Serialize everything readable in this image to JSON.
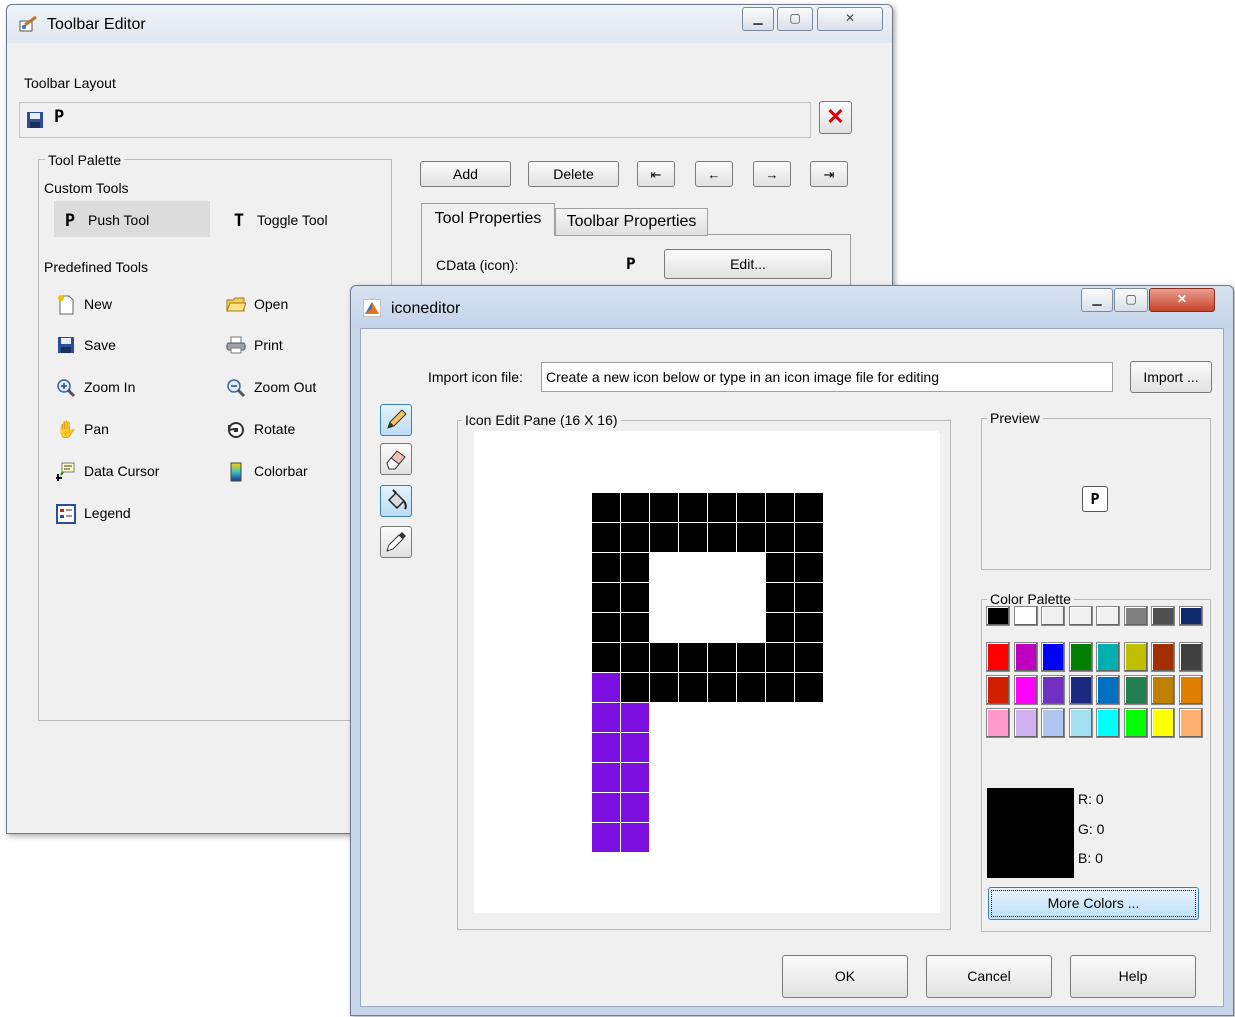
{
  "toolbar_editor": {
    "title": "Toolbar Editor",
    "layout_label": "Toolbar Layout",
    "tool_palette_label": "Tool Palette",
    "custom_tools_label": "Custom Tools",
    "custom_tools": [
      {
        "label": "Push Tool",
        "icon": "push-tool-icon",
        "glyph": "P"
      },
      {
        "label": "Toggle Tool",
        "icon": "toggle-tool-icon",
        "glyph": "T"
      }
    ],
    "predefined_tools_label": "Predefined Tools",
    "predefined_tools": [
      {
        "label": "New",
        "icon": "new-file-icon"
      },
      {
        "label": "Open",
        "icon": "open-folder-icon"
      },
      {
        "label": "Save",
        "icon": "save-disk-icon"
      },
      {
        "label": "Print",
        "icon": "printer-icon"
      },
      {
        "label": "Zoom In",
        "icon": "zoom-in-icon"
      },
      {
        "label": "Zoom Out",
        "icon": "zoom-out-icon"
      },
      {
        "label": "Pan",
        "icon": "hand-pan-icon"
      },
      {
        "label": "Rotate",
        "icon": "rotate-icon"
      },
      {
        "label": "Data Cursor",
        "icon": "data-cursor-icon"
      },
      {
        "label": "Colorbar",
        "icon": "colorbar-icon"
      },
      {
        "label": "Legend",
        "icon": "legend-icon"
      }
    ],
    "add_label": "Add",
    "delete_label": "Delete",
    "tabs": [
      "Tool Properties",
      "Toolbar Properties"
    ],
    "cdata_label": "CData (icon):",
    "edit_label": "Edit..."
  },
  "iconeditor": {
    "title": "iconeditor",
    "import_label": "Import icon file:",
    "import_value": "Create a new icon below or type in an icon image file for editing",
    "import_button": "Import ...",
    "edit_pane_label": "Icon Edit Pane (16 X 16)",
    "preview_label": "Preview",
    "color_palette_label": "Color Palette",
    "palette_colors": [
      [
        "#000000",
        "#ffffff",
        "#f0f0f0",
        "#f0f0f0",
        "#f0f0f0",
        "#808080",
        "#505050",
        "#0f2a6b"
      ],
      [
        "#ff0000",
        "#c000c0",
        "#0000ff",
        "#008000",
        "#00b0b0",
        "#c0c000",
        "#a03000",
        "#404040"
      ],
      [
        "#d02000",
        "#ff00ff",
        "#7030c0",
        "#1a2a80",
        "#0070c0",
        "#208050",
        "#c08000",
        "#e08000"
      ],
      [
        "#ff99cc",
        "#d0b0f0",
        "#b0c4f0",
        "#a0e0f0",
        "#00ffff",
        "#00ff00",
        "#ffff00",
        "#ffb070"
      ]
    ],
    "r_label": "R: 0",
    "g_label": "G: 0",
    "b_label": "B: 0",
    "current_color": "#000000",
    "more_colors": "More Colors ...",
    "ok": "OK",
    "cancel": "Cancel",
    "help": "Help",
    "tools": [
      "pencil-icon",
      "eraser-icon",
      "paint-bucket-icon",
      "eyedropper-icon"
    ],
    "pixel_colors": {
      "k": "#000000",
      "p": "#7b0fe0"
    },
    "pixels": [
      "................",
      "................",
      "....kkkkkkkk....",
      "....kkkkkkkk....",
      "....kk....kk....",
      "....kk....kk....",
      "....kk....kk....",
      "....kkkkkkkk....",
      "....pkkkkkkk....",
      "....pp..........",
      "....pp..........",
      "....pp..........",
      "....pp..........",
      "....pp..........",
      "................",
      "................"
    ]
  }
}
